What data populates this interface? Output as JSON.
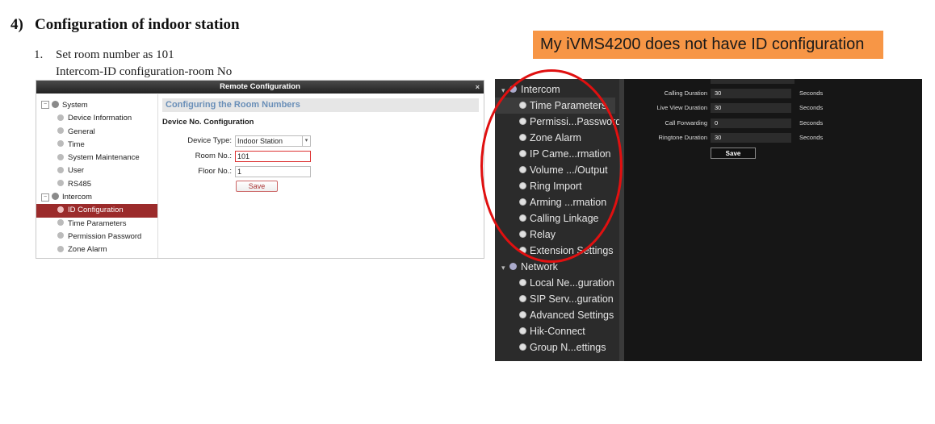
{
  "doc": {
    "heading_num": "4)",
    "heading_text": "Configuration of indoor station",
    "step_num": "1.",
    "step_text": "Set room number as 101",
    "step_sub": "Intercom-ID configuration-room No"
  },
  "callout": {
    "text": "My iVMS4200 does not have ID configuration",
    "color": "#f79646"
  },
  "remote_dialog": {
    "title": "Remote Configuration",
    "close_glyph": "×",
    "tree": [
      {
        "label": "System",
        "type": "group"
      },
      {
        "label": "Device Information",
        "type": "child"
      },
      {
        "label": "General",
        "type": "child"
      },
      {
        "label": "Time",
        "type": "child"
      },
      {
        "label": "System Maintenance",
        "type": "child"
      },
      {
        "label": "User",
        "type": "child"
      },
      {
        "label": "RS485",
        "type": "child"
      },
      {
        "label": "Intercom",
        "type": "group"
      },
      {
        "label": "ID Configuration",
        "type": "child",
        "selected": true
      },
      {
        "label": "Time Parameters",
        "type": "child"
      },
      {
        "label": "Permission Password",
        "type": "child"
      },
      {
        "label": "Zone Alarm",
        "type": "child"
      }
    ],
    "panel_title": "Configuring the Room Numbers",
    "section": "Device No. Configuration",
    "fields": {
      "device_type_label": "Device Type:",
      "device_type_value": "Indoor Station",
      "room_no_label": "Room No.:",
      "room_no_value": "101",
      "floor_no_label": "Floor No.:",
      "floor_no_value": "1"
    },
    "save_label": "Save",
    "selected_color": "#9b2b2b"
  },
  "ivms_panel": {
    "tree": [
      {
        "label": "Intercom",
        "type": "group",
        "expanded": true
      },
      {
        "label": "Time Parameters",
        "type": "child",
        "highlighted": true
      },
      {
        "label": "Permissi...Password",
        "type": "child"
      },
      {
        "label": "Zone Alarm",
        "type": "child"
      },
      {
        "label": "IP Came...rmation",
        "type": "child"
      },
      {
        "label": "Volume .../Output",
        "type": "child"
      },
      {
        "label": "Ring Import",
        "type": "child"
      },
      {
        "label": "Arming ...rmation",
        "type": "child"
      },
      {
        "label": "Calling Linkage",
        "type": "child"
      },
      {
        "label": "Relay",
        "type": "child"
      },
      {
        "label": "Extension Settings",
        "type": "child"
      },
      {
        "label": "Network",
        "type": "group",
        "expanded": true
      },
      {
        "label": "Local Ne...guration",
        "type": "child"
      },
      {
        "label": "SIP Serv...guration",
        "type": "child"
      },
      {
        "label": "Advanced Settings",
        "type": "child"
      },
      {
        "label": "Hik-Connect",
        "type": "child"
      },
      {
        "label": "Group N...ettings",
        "type": "child"
      }
    ],
    "settings": [
      {
        "label": "Calling Duration",
        "value": "30",
        "unit": "Seconds"
      },
      {
        "label": "Live View Duration",
        "value": "30",
        "unit": "Seconds"
      },
      {
        "label": "Call Forwarding",
        "value": "0",
        "unit": "Seconds"
      },
      {
        "label": "Ringtone Duration",
        "value": "30",
        "unit": "Seconds"
      }
    ],
    "save_label": "Save"
  },
  "annotation_ring_color": "#e01010"
}
